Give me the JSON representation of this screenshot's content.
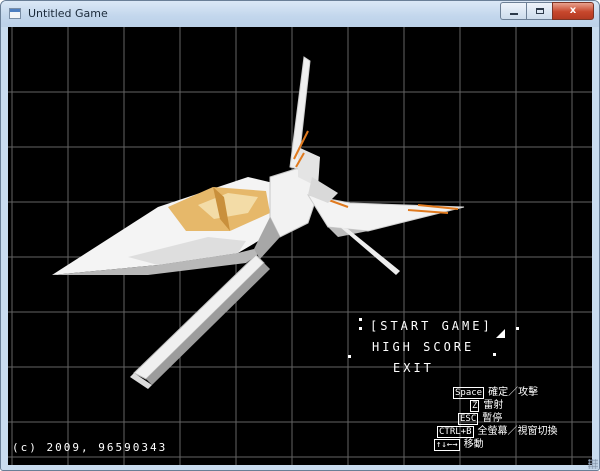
{
  "window": {
    "title": "Untitled Game",
    "icon": "app-window-icon",
    "minimize_label": "",
    "maximize_label": "",
    "close_label": "x"
  },
  "menu": {
    "start": "START GAME",
    "high_score": "HIGH SCORE",
    "exit": "EXIT",
    "selected": "START GAME"
  },
  "controls": [
    {
      "key": "Space",
      "action": "確定／攻擊"
    },
    {
      "key": "Z",
      "action": "雷射"
    },
    {
      "key": "ESC",
      "action": "暫停"
    },
    {
      "key": "CTRL+B",
      "action": "全螢幕／視窗切換"
    },
    {
      "key": "↑↓←→",
      "action": "移動"
    }
  ],
  "copyright": "(c) 2009, 96590343",
  "colors": {
    "background": "#000000",
    "grid": "#6e6e6e",
    "ship_white": "#f2f2f2",
    "ship_accent": "#e07a1f",
    "cockpit": "#e6b86a",
    "text": "#ffffff"
  }
}
